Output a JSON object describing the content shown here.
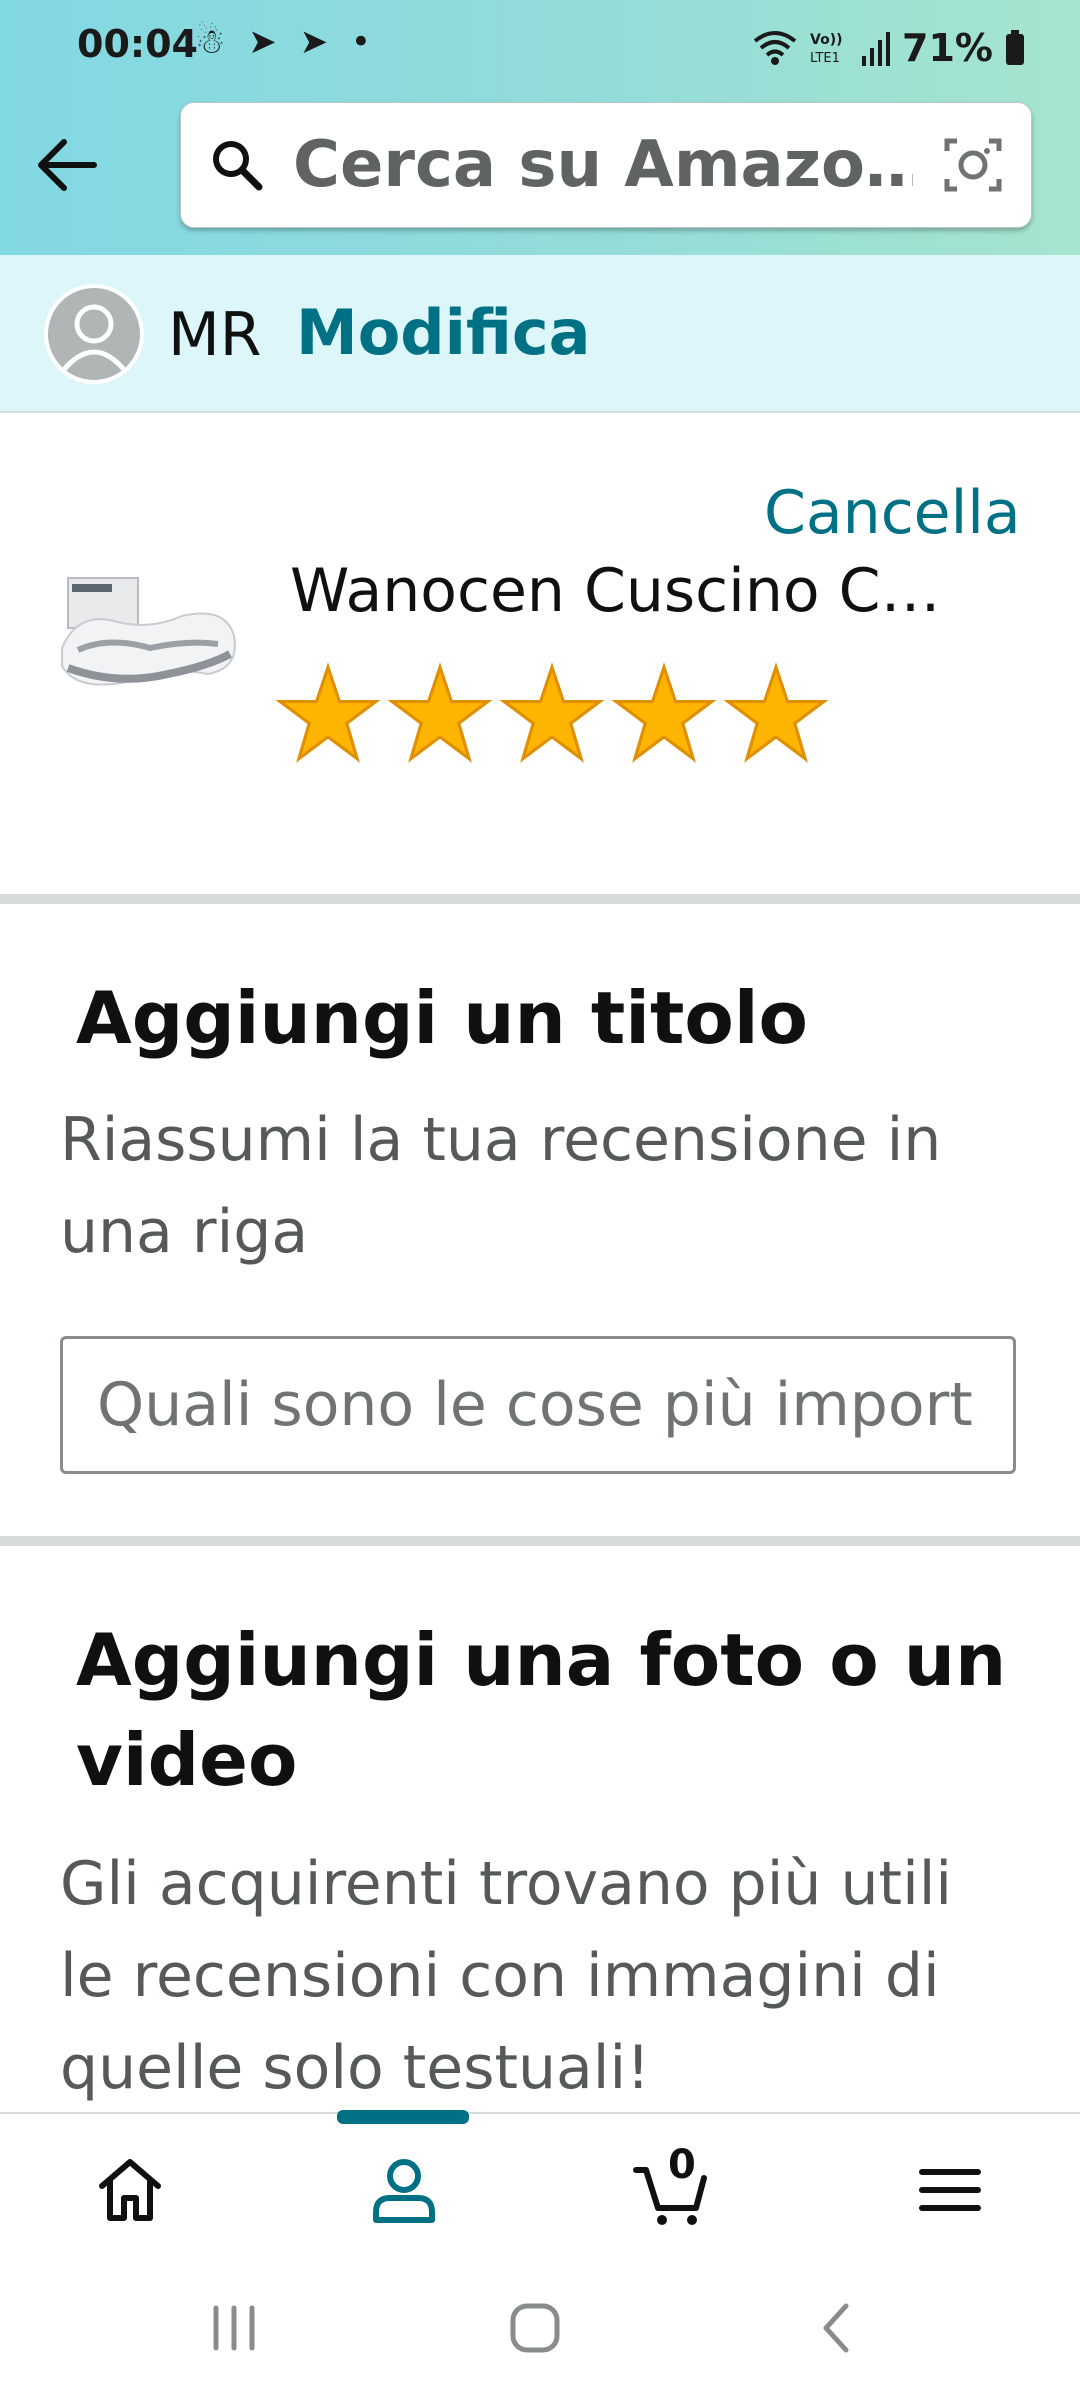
{
  "status_bar": {
    "time": "00:04",
    "notification_icons": "☃ ➤ ➤ •",
    "battery": "71%"
  },
  "search": {
    "placeholder": "Cerca su Amazo…"
  },
  "profile": {
    "initials": "MR",
    "edit_label": "Modifica"
  },
  "product": {
    "cancel_label": "Cancella",
    "title": "Wanocen Cuscino C…",
    "rating_stars": 5
  },
  "title_section": {
    "heading": "Aggiungi un titolo",
    "description_line1": "Riassumi la tua recensione in",
    "description_line2": "una riga",
    "input_placeholder": "Quali sono le cose più import"
  },
  "photo_section": {
    "heading_line1": "Aggiungi una foto o un",
    "heading_line2": "video",
    "description_line1": "Gli acquirenti trovano più utili",
    "description_line2": "le recensioni con immagini di",
    "description_line3": "quelle solo testuali!"
  },
  "bottom_nav": {
    "cart_count": "0",
    "items": [
      "home-icon",
      "account-icon",
      "cart-icon",
      "menu-icon"
    ],
    "active": "account-icon"
  },
  "colors": {
    "link": "#007185",
    "star": "#ffa41c",
    "header_gradient_start": "#82d8e3",
    "header_gradient_end": "#a6e4cf",
    "profile_bar": "#ddf6fa"
  }
}
